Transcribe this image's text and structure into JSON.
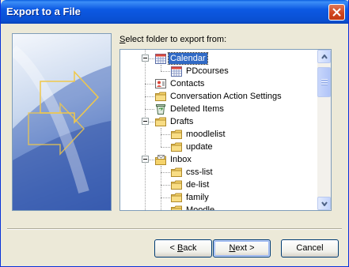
{
  "window": {
    "title": "Export to a File"
  },
  "prompt": {
    "before": "",
    "accel": "S",
    "after": "elect folder to export from:"
  },
  "tree": {
    "items": [
      {
        "label": "Calendar",
        "icon": "calendar-icon",
        "level": 1,
        "expander": "minus",
        "selected": true
      },
      {
        "label": "PDcourses",
        "icon": "calendar-icon",
        "level": 2,
        "expander": "none",
        "selected": false
      },
      {
        "label": "Contacts",
        "icon": "contacts-icon",
        "level": 1,
        "expander": "none",
        "selected": false
      },
      {
        "label": "Conversation Action Settings",
        "icon": "folder-icon",
        "level": 1,
        "expander": "none",
        "selected": false
      },
      {
        "label": "Deleted Items",
        "icon": "deleted-items-icon",
        "level": 1,
        "expander": "none",
        "selected": false
      },
      {
        "label": "Drafts",
        "icon": "folder-icon",
        "level": 1,
        "expander": "minus",
        "selected": false
      },
      {
        "label": "moodlelist",
        "icon": "folder-icon",
        "level": 2,
        "expander": "none",
        "selected": false
      },
      {
        "label": "update",
        "icon": "folder-icon",
        "level": 2,
        "expander": "none",
        "selected": false
      },
      {
        "label": "Inbox",
        "icon": "inbox-icon",
        "level": 1,
        "expander": "minus",
        "selected": false
      },
      {
        "label": "css-list",
        "icon": "folder-icon",
        "level": 2,
        "expander": "none",
        "selected": false
      },
      {
        "label": "de-list",
        "icon": "folder-icon",
        "level": 2,
        "expander": "none",
        "selected": false
      },
      {
        "label": "family",
        "icon": "folder-icon",
        "level": 2,
        "expander": "none",
        "selected": false
      },
      {
        "label": "Moodle",
        "icon": "folder-icon",
        "level": 2,
        "expander": "none",
        "selected": false
      }
    ]
  },
  "buttons": {
    "back": {
      "before": "< ",
      "accel": "B",
      "after": "ack"
    },
    "next": {
      "before": "",
      "accel": "N",
      "after": "ext >"
    },
    "cancel": {
      "label": "Cancel"
    }
  },
  "colors": {
    "titlebar": "#0a4fd1",
    "selection": "#316ac5",
    "dialog_bg": "#ece9d8",
    "folder": "#f5d36b"
  }
}
